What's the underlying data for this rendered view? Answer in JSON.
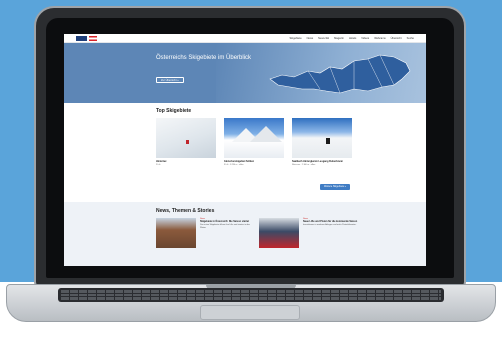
{
  "colors": {
    "background": "#5aa4da",
    "hero": "#5d86b6",
    "accent": "#3f7cc4"
  },
  "nav": {
    "links": [
      "Skigebiete",
      "News",
      "News-Ski",
      "Magazin",
      "Hotels",
      "Videos",
      "Webcams",
      "Übersicht",
      "Suche"
    ]
  },
  "hero": {
    "title": "Österreichs Skigebiete im Überblick",
    "button_label": "Zur Übersicht »"
  },
  "top": {
    "heading": "Top Skigebiete",
    "cards": [
      {
        "title": "Hintertux",
        "meta": "2 Lift"
      },
      {
        "title": "Gletscherskigebiet Sölden",
        "meta": "3 Lift  · 3.250 m  · offen"
      },
      {
        "title": "Saalbach Hinterglemm Leogang Fieberbrunn",
        "meta": "Skicircus · 2.100 m · offen"
      }
    ],
    "more_label": "Weitere Skigebiete »"
  },
  "news": {
    "heading": "News, Themen & Stories",
    "items": [
      {
        "tag": "News",
        "title": "Skigebiete in Österreich: Die Saison startet",
        "text": "Die ersten Skigebiete öffnen ihre Lifte und starten in den Winter."
      },
      {
        "tag": "News",
        "title": "Neue Lifte und Pisten für die kommende Saison",
        "text": "Investitionen in moderne Anlagen und mehr Pistenkilometer."
      }
    ]
  }
}
